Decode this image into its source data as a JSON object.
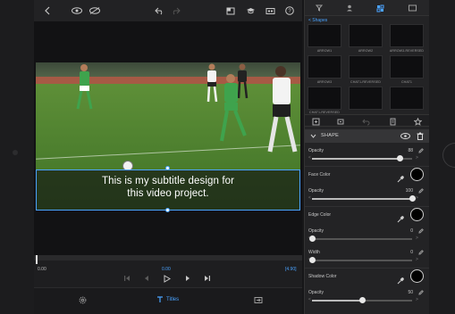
{
  "subtitle": {
    "line1": "This is my subtitle design for",
    "line2": "this video project."
  },
  "timeline": {
    "current_time": "0.00",
    "center_time": "0.00",
    "end_time": "[4.90]"
  },
  "bottombar": {
    "titles_label": "Titles"
  },
  "panel": {
    "breadcrumb": "< Shapes",
    "shapes": [
      "ARROW1",
      "ARROW2",
      "ARROW3-REVERSED",
      "ARROW3",
      "CHAT1-REVERSED",
      "CHAT1",
      "CHAT1-REVERSED",
      "",
      ""
    ],
    "section_title": "SHAPE",
    "props": {
      "opacity1_label": "Opacity",
      "opacity1_value": "88",
      "opacity1_level": 0.88,
      "face_color_label": "Face Color",
      "opacity2_label": "Opacity",
      "opacity2_value": "100",
      "opacity2_level": 1.0,
      "edge_color_label": "Edge Color",
      "opacity3_label": "Opacity",
      "opacity3_value": "0",
      "opacity3_level": 0.0,
      "width_label": "Width",
      "width_value": "0",
      "width_level": 0.0,
      "shadow_color_label": "Shadow Color",
      "opacity4_label": "Opacity",
      "opacity4_value": "50",
      "opacity4_level": 0.5
    }
  },
  "colors": {
    "accent": "#4aa3ff",
    "face_color": "#000000",
    "edge_color": "#000000",
    "shadow_color": "#000000"
  }
}
